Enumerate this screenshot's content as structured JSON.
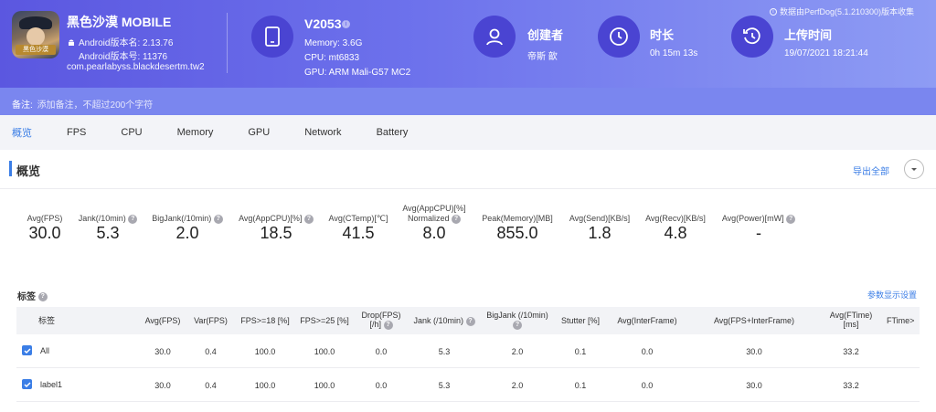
{
  "app": {
    "name": "黑色沙漠 MOBILE",
    "version_name": "Android版本名: 2.13.76",
    "version_code": "Android版本号: 11376",
    "package": "com.pearlabyss.blackdesertm.tw2",
    "icon_tag": "黑色沙漠"
  },
  "device": {
    "model": "V2053",
    "memory": "Memory: 3.6G",
    "cpu": "CPU: mt6833",
    "gpu": "GPU: ARM Mali-G57 MC2"
  },
  "meta": {
    "creator_label": "创建者",
    "creator_value": "帝斯 歆",
    "duration_label": "时长",
    "duration_value": "0h 15m 13s",
    "upload_label": "上传时间",
    "upload_value": "19/07/2021 18:21:44"
  },
  "perfdog_note": "数据由PerfDog(5.1.210300)版本收集",
  "remark": {
    "label": "备注:",
    "placeholder": "添加备注，不超过200个字符"
  },
  "tabs": [
    "概览",
    "FPS",
    "CPU",
    "Memory",
    "GPU",
    "Network",
    "Battery"
  ],
  "active_tab": "概览",
  "overview": {
    "title": "概览",
    "export_label": "导出全部",
    "metrics": [
      {
        "label": "Avg(FPS)",
        "value": "30.0",
        "help": false
      },
      {
        "label": "Jank(/10min)",
        "value": "5.3",
        "help": true
      },
      {
        "label": "BigJank(/10min)",
        "value": "2.0",
        "help": true
      },
      {
        "label": "Avg(AppCPU)[%]",
        "value": "18.5",
        "help": true
      },
      {
        "label": "Avg(CTemp)[℃]",
        "value": "41.5",
        "help": false
      },
      {
        "label": "Avg(AppCPU)[%]",
        "label2": "Normalized",
        "value": "8.0",
        "help": true
      },
      {
        "label": "Peak(Memory)[MB]",
        "value": "855.0",
        "help": false
      },
      {
        "label": "Avg(Send)[KB/s]",
        "value": "1.8",
        "help": false
      },
      {
        "label": "Avg(Recv)[KB/s]",
        "value": "4.8",
        "help": false
      },
      {
        "label": "Avg(Power)[mW]",
        "value": "-",
        "help": true
      }
    ]
  },
  "tags": {
    "title": "标签",
    "param_link": "参数显示设置",
    "columns": [
      "标签",
      "Avg(FPS)",
      "Var(FPS)",
      "FPS>=18 [%]",
      "FPS>=25 [%]",
      "Drop(FPS)",
      "[/h]",
      "Jank (/10min)",
      "BigJank (/10min)",
      "Stutter [%]",
      "Avg(InterFrame)",
      "Avg(FPS+InterFrame)",
      "Avg(FTime)",
      "[ms]",
      "FTime>"
    ],
    "rows": [
      {
        "label": "All",
        "values": [
          "30.0",
          "0.4",
          "100.0",
          "100.0",
          "0.0",
          "5.3",
          "2.0",
          "0.1",
          "0.0",
          "30.0",
          "33.2"
        ]
      },
      {
        "label": "label1",
        "values": [
          "30.0",
          "0.4",
          "100.0",
          "100.0",
          "0.0",
          "5.3",
          "2.0",
          "0.1",
          "0.0",
          "30.0",
          "33.2"
        ]
      }
    ]
  }
}
